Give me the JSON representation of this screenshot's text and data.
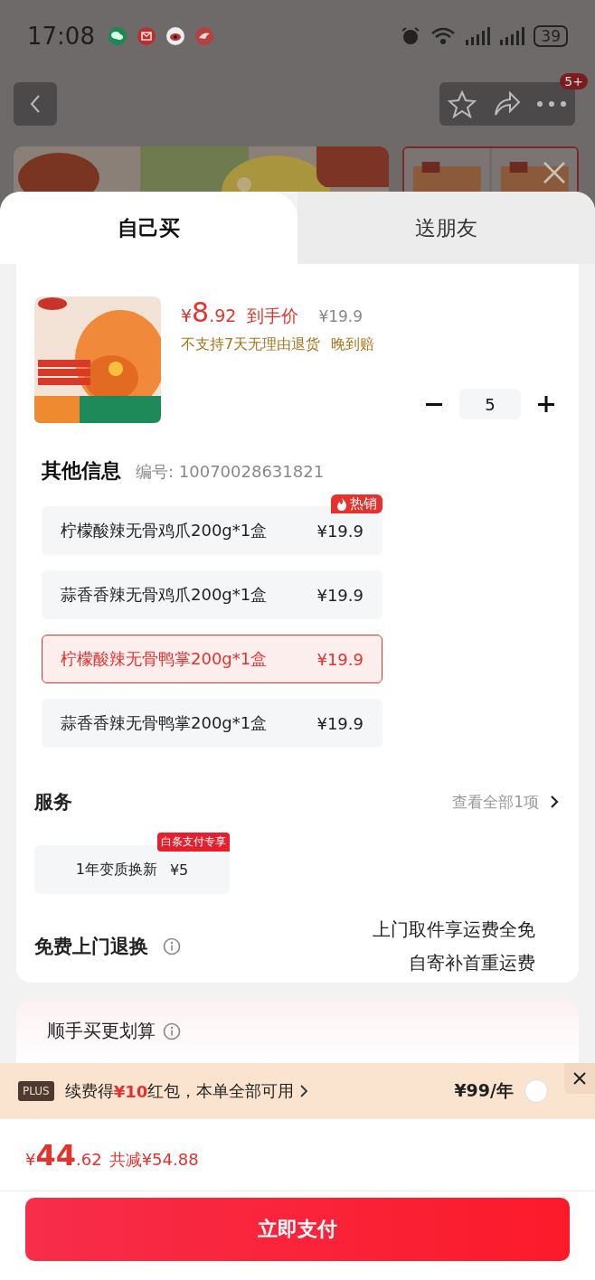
{
  "status_bar": {
    "time": "17:08",
    "battery": "39"
  },
  "nav": {
    "badge": "5+"
  },
  "tabs": [
    {
      "label": "自己买",
      "selected": true
    },
    {
      "label": "送朋友",
      "selected": false
    }
  ],
  "product": {
    "currency": "¥",
    "price_int": "8",
    "price_dec": ".92",
    "price_label": "到手价",
    "original_price": "¥19.9",
    "return_note": "不支持7天无理由退货",
    "late_note": "晚到赔",
    "quantity": "5"
  },
  "other_info": {
    "title": "其他信息",
    "code": "编号: 10070028631821"
  },
  "options": [
    {
      "name": "柠檬酸辣无骨鸡爪200g*1盒",
      "price": "¥19.9",
      "selected": false,
      "badge": "热销"
    },
    {
      "name": "蒜香香辣无骨鸡爪200g*1盒",
      "price": "¥19.9",
      "selected": false
    },
    {
      "name": "柠檬酸辣无骨鸭掌200g*1盒",
      "price": "¥19.9",
      "selected": true
    },
    {
      "name": "蒜香香辣无骨鸭掌200g*1盒",
      "price": "¥19.9",
      "selected": false
    }
  ],
  "service": {
    "title": "服务",
    "view_all": "查看全部1项",
    "items": [
      {
        "name": "1年变质换新",
        "price": "¥5",
        "badge": "白条支付专享"
      }
    ]
  },
  "free_return": {
    "title": "免费上门退换",
    "lines": [
      "上门取件享运费全免",
      "自寄补首重运费"
    ]
  },
  "bundle": {
    "title": "顺手买更划算"
  },
  "plus_bar": {
    "badge": "PLUS",
    "text_before": "续费得",
    "highlight": "¥10",
    "text_after": "红包，本单全部可用",
    "price": "¥99/年",
    "checked": false
  },
  "total": {
    "currency": "¥",
    "int": "44",
    "dec": ".62",
    "saving": "共减¥54.88"
  },
  "pay_button": "立即支付"
}
